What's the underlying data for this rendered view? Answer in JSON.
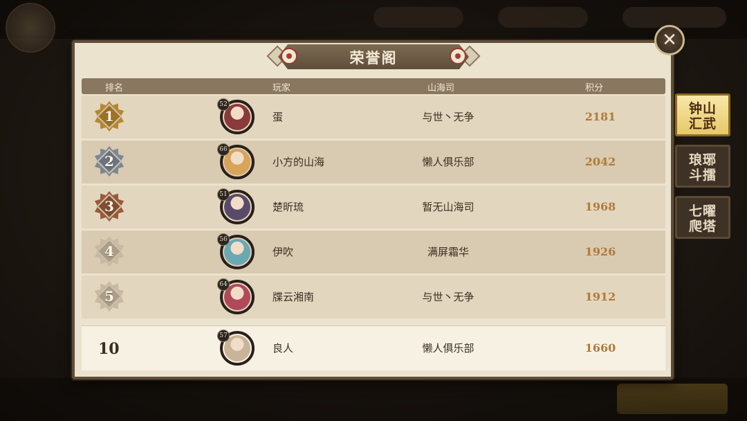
{
  "title": "荣誉阁",
  "columns": {
    "rank": "排名",
    "player": "玩家",
    "guild": "山海司",
    "score": "积分"
  },
  "rows": [
    {
      "rank": "1",
      "level": "52",
      "name": "蛋",
      "guild": "与世丶无争",
      "score": "2181",
      "badge_color": "#b8862e",
      "face_color": "#8a3a3a"
    },
    {
      "rank": "2",
      "level": "66",
      "name": "小方的山海",
      "guild": "懒人俱乐部",
      "score": "2042",
      "badge_color": "#7d8796",
      "face_color": "#d8a45a"
    },
    {
      "rank": "3",
      "level": "51",
      "name": "楚昕琉",
      "guild": "暂无山海司",
      "score": "1968",
      "badge_color": "#9a5a3a",
      "face_color": "#5a4a6a"
    },
    {
      "rank": "4",
      "level": "56",
      "name": "伊吹",
      "guild": "满屏霜华",
      "score": "1926",
      "badge_color": "#c9b9a0",
      "face_color": "#6aa8b4"
    },
    {
      "rank": "5",
      "level": "64",
      "name": "牒云湘南",
      "guild": "与世丶无争",
      "score": "1912",
      "badge_color": "#c9b9a0",
      "face_color": "#b04a5a"
    }
  ],
  "my_row": {
    "rank": "10",
    "level": "57",
    "name": "良人",
    "guild": "懒人俱乐部",
    "score": "1660",
    "face_color": "#c9b49a"
  },
  "side_tabs": [
    {
      "label_line1": "钟山",
      "label_line2": "汇武",
      "active": true
    },
    {
      "label_line1": "琅琊",
      "label_line2": "斗擂",
      "active": false
    },
    {
      "label_line1": "七曜",
      "label_line2": "爬塔",
      "active": false
    }
  ],
  "close_label": "✕"
}
